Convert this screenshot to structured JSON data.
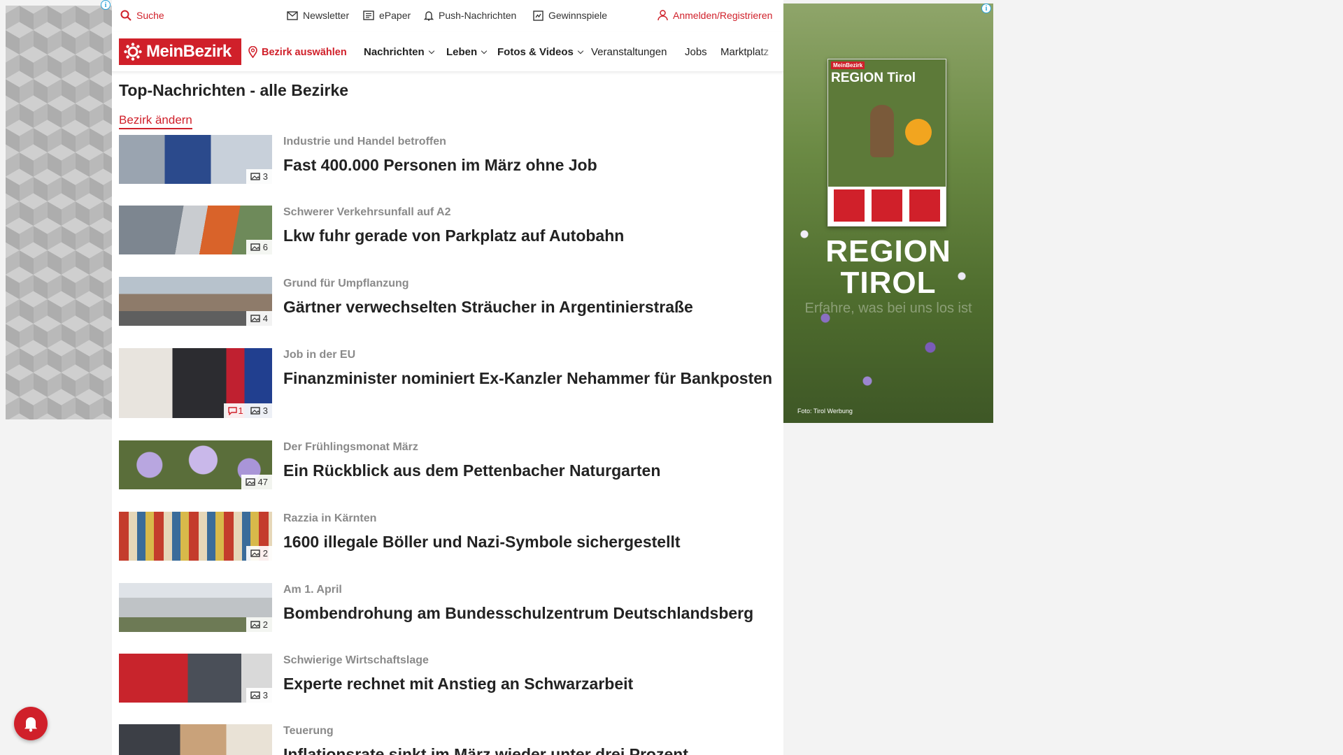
{
  "topbar": {
    "search": "Suche",
    "newsletter": "Newsletter",
    "epaper": "ePaper",
    "push": "Push-Nachrichten",
    "gewinnspiele": "Gewinnspiele",
    "login": "Anmelden/Registrieren"
  },
  "nav": {
    "logo": "MeinBezirk",
    "bezirk": "Bezirk auswählen",
    "items": [
      "Nachrichten",
      "Leben",
      "Fotos & Videos",
      "Veranstaltungen",
      "Jobs",
      "Marktplatz"
    ]
  },
  "page": {
    "title": "Top-Nachrichten - alle Bezirke",
    "change_district": "Bezirk ändern"
  },
  "articles": [
    {
      "kicker": "Industrie und Handel betroffen",
      "title": "Fast 400.000 Personen im März ohne Job",
      "photos": "3",
      "comments": ""
    },
    {
      "kicker": "Schwerer Verkehrsunfall auf A2",
      "title": "Lkw fuhr gerade von Parkplatz auf Autobahn",
      "photos": "6",
      "comments": ""
    },
    {
      "kicker": "Grund für Umpflanzung",
      "title": "Gärtner verwechselten Sträucher in Argentinierstraße",
      "photos": "4",
      "comments": ""
    },
    {
      "kicker": "Job in der EU",
      "title": "Finanzminister nominiert Ex-Kanzler Nehammer für Bankposten",
      "photos": "3",
      "comments": "1"
    },
    {
      "kicker": "Der Frühlingsmonat März",
      "title": "Ein Rückblick aus dem Pettenbacher Naturgarten",
      "photos": "47",
      "comments": ""
    },
    {
      "kicker": "Razzia in Kärnten",
      "title": "1600 illegale Böller und Nazi-Symbole sichergestellt",
      "photos": "2",
      "comments": ""
    },
    {
      "kicker": "Am 1. April",
      "title": "Bombendrohung am Bundesschulzentrum Deutschlandsberg",
      "photos": "2",
      "comments": ""
    },
    {
      "kicker": "Schwierige Wirtschaftslage",
      "title": "Experte rechnet mit Anstieg an Schwarzarbeit",
      "photos": "3",
      "comments": ""
    },
    {
      "kicker": "Teuerung",
      "title": "Inflationsrate sinkt im März wieder unter drei Prozent",
      "photos": "",
      "comments": ""
    }
  ],
  "ad": {
    "magazine_label": "MeinBezirk",
    "magazine_title": "REGION Tirol",
    "headline_line1": "REGION",
    "headline_line2": "TIROL",
    "tagline": "Erfahre, was bei uns los ist",
    "credit": "Foto: Tirol Werbung",
    "info": "i"
  },
  "colors": {
    "brand": "#d0202a",
    "kicker": "#8a8a8a"
  }
}
